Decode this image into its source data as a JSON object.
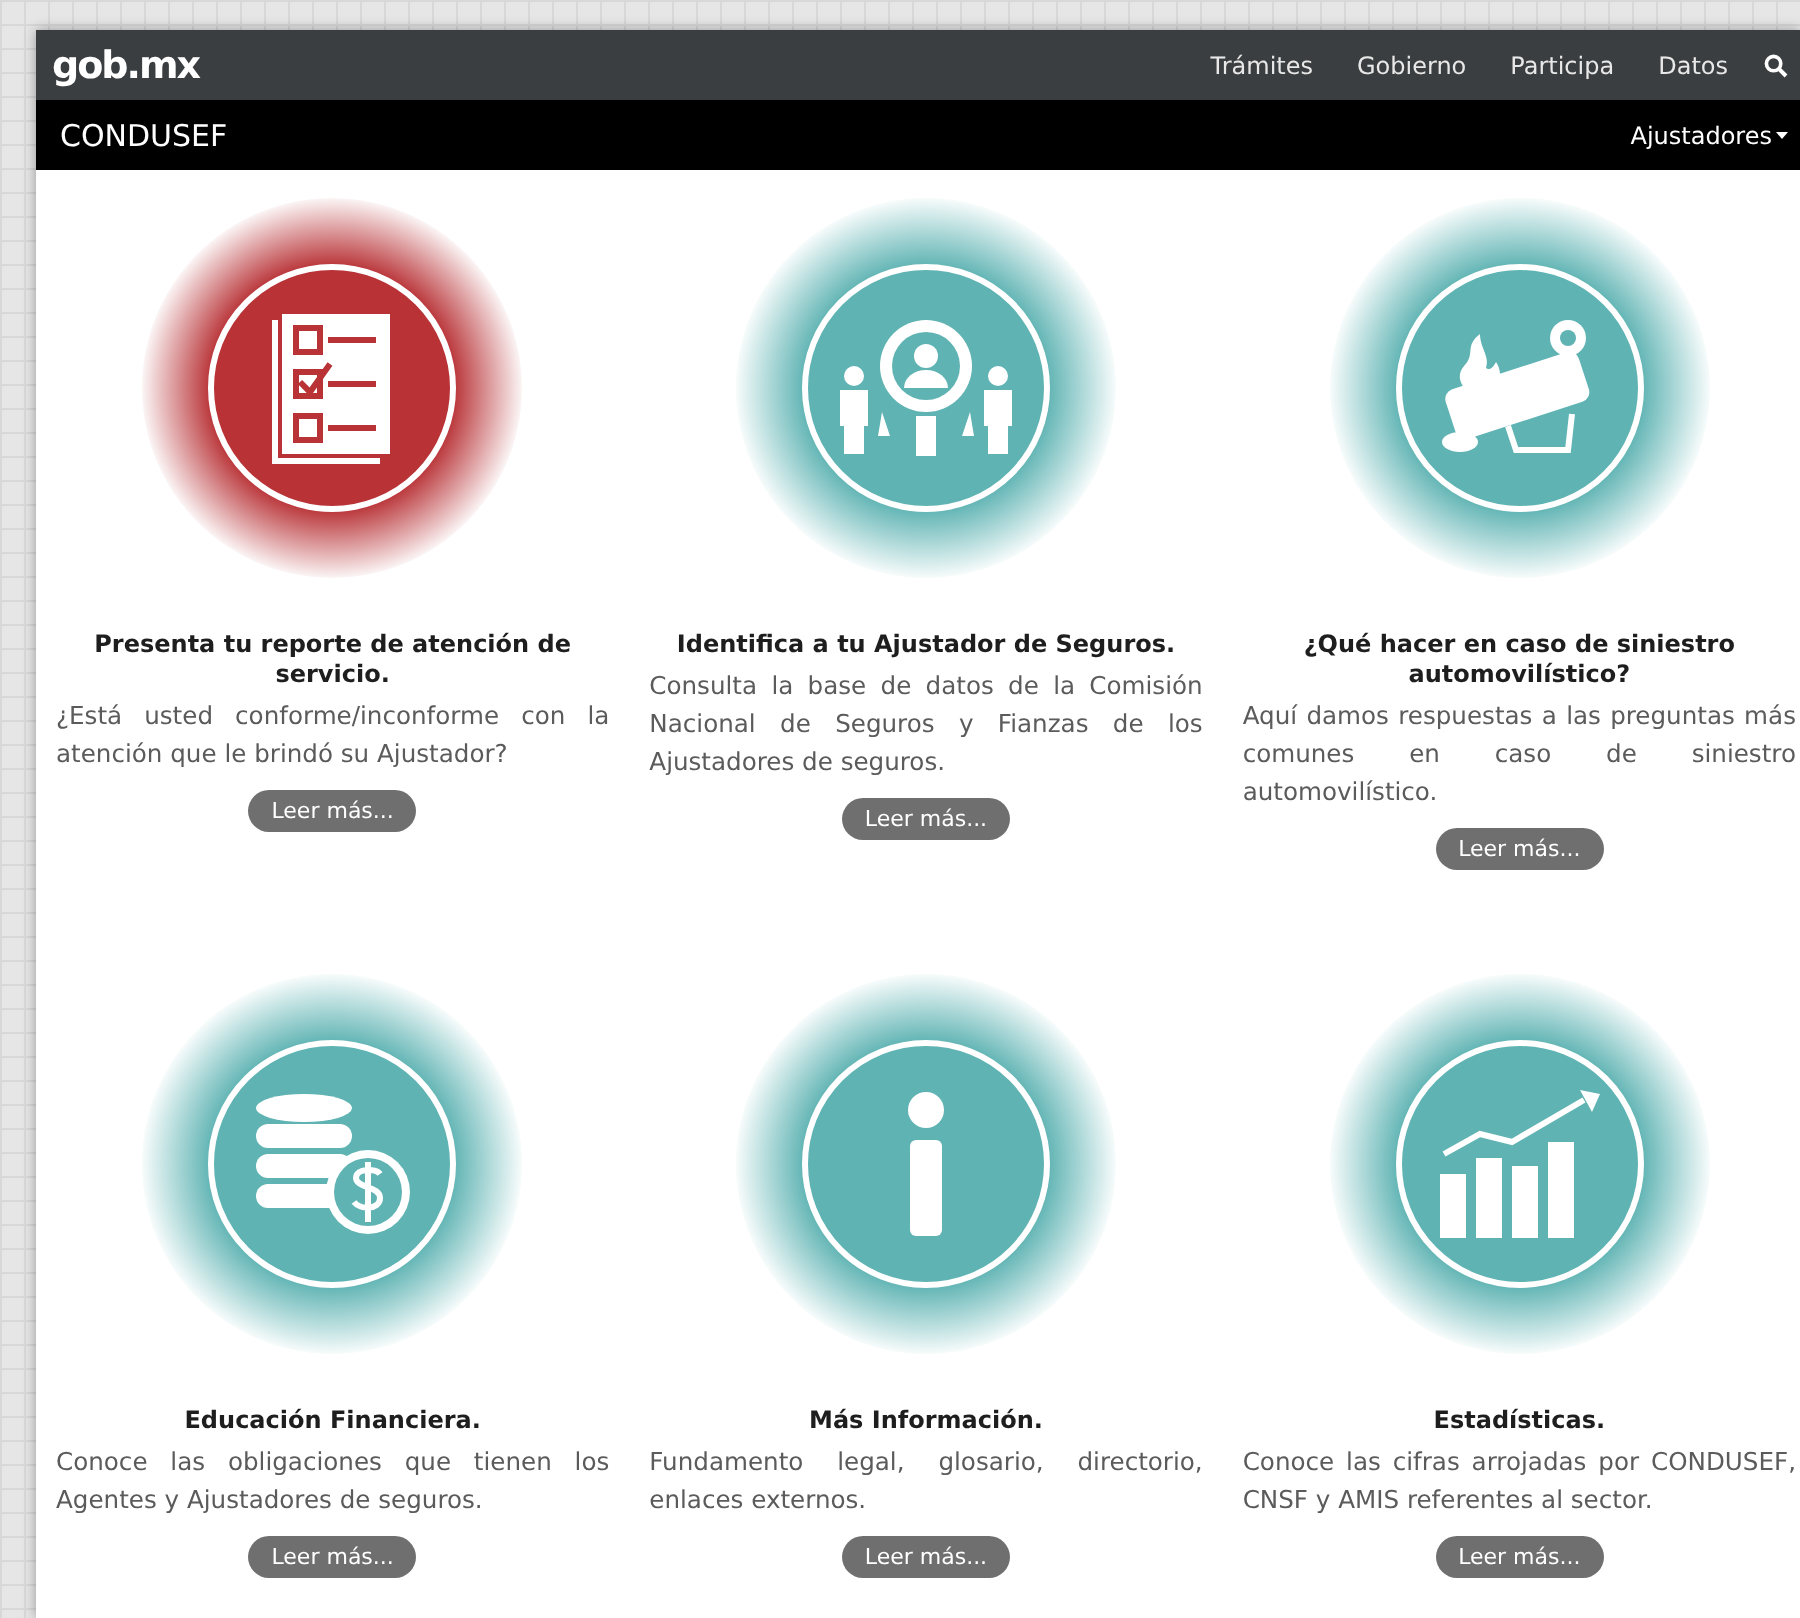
{
  "topbar": {
    "logo": "gob.mx",
    "nav": [
      "Trámites",
      "Gobierno",
      "Participa",
      "Datos"
    ]
  },
  "subbar": {
    "title": "CONDUSEF",
    "menu": "Ajustadores"
  },
  "cards": [
    {
      "kind": "checklist",
      "color": "#b83236",
      "title": "Presenta tu reporte de atención de servicio.",
      "text": "¿Está usted conforme/inconforme con la atención que le brindó su Ajustador?",
      "button": "Leer más..."
    },
    {
      "kind": "people-search",
      "color": "#5fb3b3",
      "title": "Identifica a tu Ajustador de Seguros.",
      "text": "Consulta la base de datos de la Comisión Nacional de Seguros y Fianzas de los Ajustadores de seguros.",
      "button": "Leer más..."
    },
    {
      "kind": "car-crash",
      "color": "#5fb3b3",
      "title": "¿Qué hacer en caso de siniestro automovilístico?",
      "text": "Aquí damos respuestas a las preguntas más comunes en caso de siniestro automovilístico.",
      "button": "Leer más..."
    },
    {
      "kind": "coins",
      "color": "#5fb3b3",
      "title": "Educación Financiera.",
      "text": "Conoce las obligaciones que tienen los Agentes y Ajustadores de seguros.",
      "button": "Leer más..."
    },
    {
      "kind": "info",
      "color": "#5fb3b3",
      "title": "Más Información.",
      "text": "Fundamento legal, glosario, directorio, enlaces externos.",
      "button": "Leer más..."
    },
    {
      "kind": "chart",
      "color": "#5fb3b3",
      "title": "Estadísticas.",
      "text": "Conoce las cifras arrojadas por CONDUSEF, CNSF y AMIS referentes al sector.",
      "button": "Leer más..."
    }
  ]
}
